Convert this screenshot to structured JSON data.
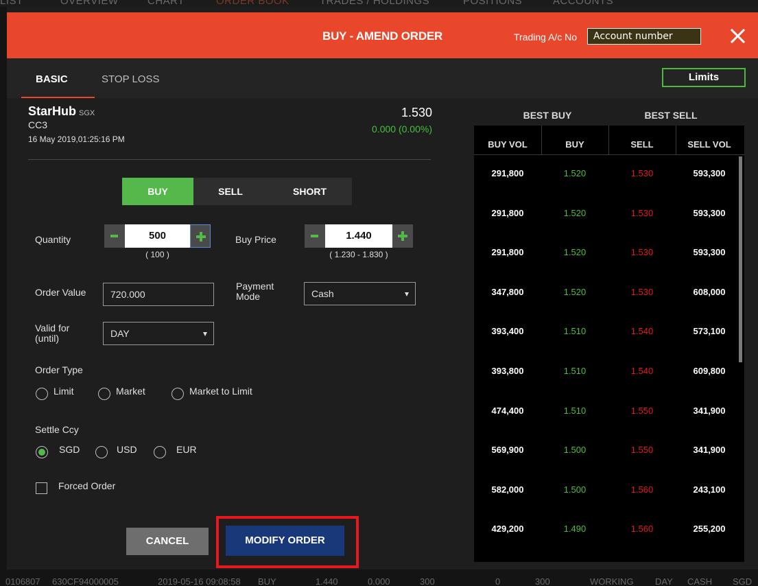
{
  "background": {
    "tabs": [
      "LIST",
      "OVERVIEW",
      "CHART",
      "ORDER BOOK",
      "TRADES / HOLDINGS",
      "POSITIONS",
      "ACCOUNTS"
    ],
    "row": [
      "0106807",
      "630CF94000005",
      "2019-05-16 09:08:58",
      "BUY",
      "1.440",
      "0.000",
      "300",
      "0",
      "300",
      "WORKING",
      "DAY",
      "CASH",
      "SGD"
    ]
  },
  "dialog": {
    "title": "BUY - AMEND ORDER",
    "account_label": "Trading A/c No",
    "account_value": "Account number"
  },
  "tabs": {
    "basic": "BASIC",
    "stop_loss": "STOP LOSS",
    "limits": "Limits"
  },
  "stock": {
    "name": "StarHub",
    "exchange": "SGX",
    "code": "CC3",
    "datetime": "16 May 2019,01:25:16 PM",
    "price": "1.530",
    "change": "0.000 (0.00%)"
  },
  "side": {
    "buy": "BUY",
    "sell": "SELL",
    "short": "SHORT",
    "selected": "BUY"
  },
  "form": {
    "quantity_label": "Quantity",
    "quantity_value": "500",
    "quantity_hint": "( 100 )",
    "buy_price_label": "Buy Price",
    "buy_price_value": "1.440",
    "buy_price_hint": "( 1.230 - 1.830 )",
    "order_value_label": "Order Value",
    "order_value": "720.000",
    "payment_mode_label": "Payment Mode",
    "payment_mode_value": "Cash",
    "valid_for_label": "Valid for (until)",
    "valid_for_value": "DAY",
    "order_type_label": "Order Type",
    "order_types": [
      "Limit",
      "Market",
      "Market to Limit"
    ],
    "settle_ccy_label": "Settle Ccy",
    "settle_ccys": [
      "SGD",
      "USD",
      "EUR"
    ],
    "settle_ccy_selected": "SGD",
    "forced_order_label": "Forced Order"
  },
  "buttons": {
    "cancel": "CANCEL",
    "modify": "MODIFY ORDER"
  },
  "order_book": {
    "best_buy": "BEST BUY",
    "best_sell": "BEST SELL",
    "columns": [
      "BUY VOL",
      "BUY",
      "SELL",
      "SELL VOL"
    ],
    "rows": [
      {
        "buy_vol": "291,800",
        "buy": "1.520",
        "sell": "1.530",
        "sell_vol": "593,300"
      },
      {
        "buy_vol": "291,800",
        "buy": "1.520",
        "sell": "1.530",
        "sell_vol": "593,300"
      },
      {
        "buy_vol": "291,800",
        "buy": "1.520",
        "sell": "1.530",
        "sell_vol": "593,300"
      },
      {
        "buy_vol": "347,800",
        "buy": "1.520",
        "sell": "1.530",
        "sell_vol": "608,000"
      },
      {
        "buy_vol": "393,400",
        "buy": "1.510",
        "sell": "1.540",
        "sell_vol": "573,100"
      },
      {
        "buy_vol": "393,800",
        "buy": "1.510",
        "sell": "1.540",
        "sell_vol": "609,800"
      },
      {
        "buy_vol": "474,400",
        "buy": "1.510",
        "sell": "1.550",
        "sell_vol": "341,900"
      },
      {
        "buy_vol": "569,900",
        "buy": "1.500",
        "sell": "1.550",
        "sell_vol": "341,900"
      },
      {
        "buy_vol": "582,000",
        "buy": "1.500",
        "sell": "1.560",
        "sell_vol": "243,100"
      },
      {
        "buy_vol": "429,200",
        "buy": "1.490",
        "sell": "1.560",
        "sell_vol": "255,200"
      }
    ]
  },
  "colors": {
    "header": "#e8472c",
    "buy_green": "#54b84a",
    "sell_red": "#e8181e",
    "modify_blue": "#19387a"
  }
}
